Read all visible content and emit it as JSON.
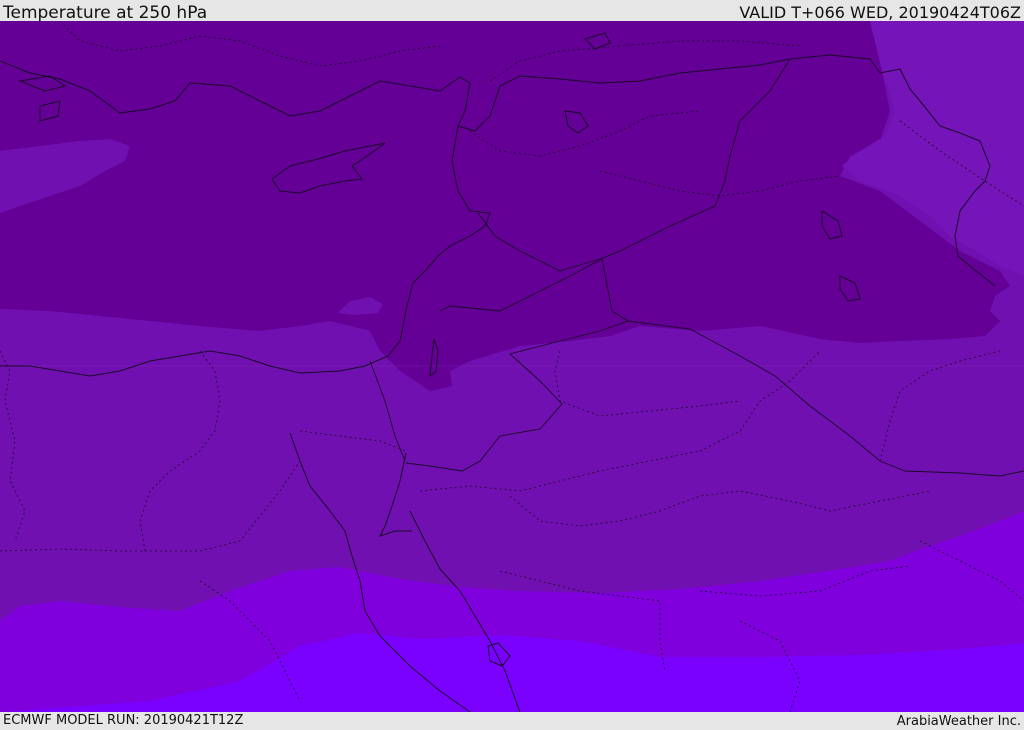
{
  "header": {
    "title": "Temperature at 250 hPa",
    "valid": "VALID T+066 WED, 20190424T06Z"
  },
  "footer": {
    "model_run": "ECMWF MODEL RUN: 20190421T12Z",
    "credit": "ArabiaWeather Inc."
  },
  "map": {
    "colors": {
      "band_darkest": "#640096",
      "band_dark": "#7110b0",
      "band_mid": "#7f00dc",
      "band_bright": "#7a00ff",
      "band_northeast": "#7514b8",
      "boundary_line": "#1a0a2a"
    }
  }
}
